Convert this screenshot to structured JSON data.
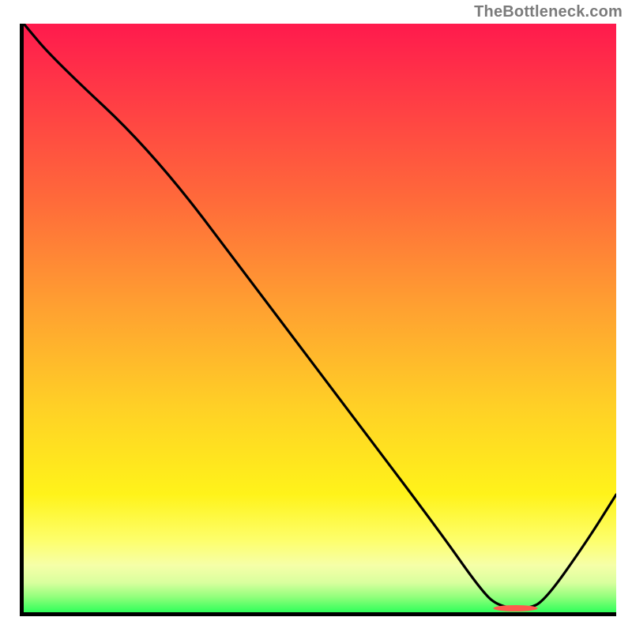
{
  "attribution": "TheBottleneck.com",
  "chart_data": {
    "type": "line",
    "title": "",
    "xlabel": "",
    "ylabel": "",
    "xlim": [
      0,
      100
    ],
    "ylim": [
      0,
      100
    ],
    "series": [
      {
        "name": "curve",
        "x": [
          0,
          5,
          22,
          40,
          55,
          70,
          77,
          80,
          85,
          88,
          95,
          100
        ],
        "values": [
          100,
          94,
          78,
          54,
          34,
          14,
          4,
          1,
          0.5,
          2,
          12,
          20
        ]
      }
    ],
    "bump": {
      "x": 83,
      "label": ""
    },
    "gradient_stops": [
      {
        "pct": 0,
        "color": "#ff1a4d"
      },
      {
        "pct": 10,
        "color": "#ff3547"
      },
      {
        "pct": 30,
        "color": "#ff6a3a"
      },
      {
        "pct": 48,
        "color": "#ffa031"
      },
      {
        "pct": 65,
        "color": "#ffd026"
      },
      {
        "pct": 80,
        "color": "#fff31a"
      },
      {
        "pct": 88,
        "color": "#fdff6e"
      },
      {
        "pct": 92,
        "color": "#f6ffa8"
      },
      {
        "pct": 95,
        "color": "#d9ff9e"
      },
      {
        "pct": 97.5,
        "color": "#8eff7a"
      },
      {
        "pct": 100,
        "color": "#2fff5a"
      }
    ]
  }
}
